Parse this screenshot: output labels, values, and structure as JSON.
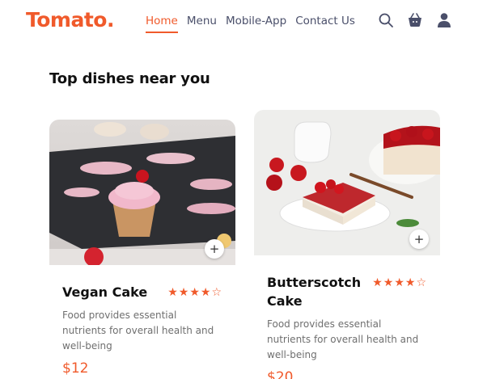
{
  "brand": {
    "logo": "Tomato."
  },
  "nav": {
    "items": [
      {
        "label": "Home",
        "active": true
      },
      {
        "label": "Menu"
      },
      {
        "label": "Mobile-App"
      },
      {
        "label": "Contact Us"
      }
    ]
  },
  "header_icons": [
    "search-icon",
    "basket-icon",
    "profile-icon"
  ],
  "section": {
    "title": "Top dishes near you"
  },
  "dishes": [
    {
      "name": "Vegan Cake",
      "rating": 4,
      "stars": "★★★★☆",
      "description": "Food provides essential nutrients for overall health and well-being",
      "price": "$12",
      "add_label": "+"
    },
    {
      "name": "Butterscotch Cake",
      "rating": 4,
      "stars": "★★★★☆",
      "description": "Food provides essential nutrients for overall health and well-being",
      "price": "$20",
      "add_label": "+"
    }
  ],
  "colors": {
    "accent": "#f05a2b",
    "text": "#262626",
    "muted": "#6f6f6f",
    "nav": "#4a4f6a"
  }
}
